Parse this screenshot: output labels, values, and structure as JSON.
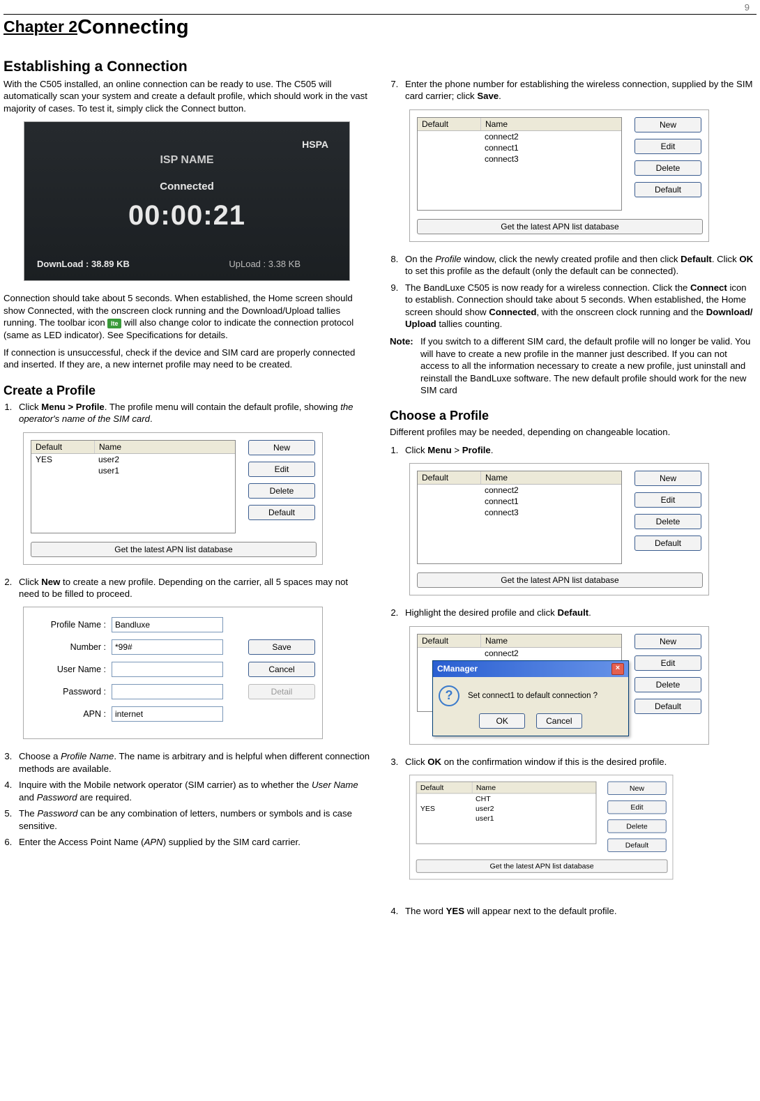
{
  "page_number": "9",
  "chapter": {
    "label": "Chapter 2",
    "title": "Connecting"
  },
  "sec_establish": "Establishing a Connection",
  "p_intro": "With the C505 installed, an online connection can be ready to use. The C505 will automatically scan your system and create a default profile, which should work in the vast majority of cases. To test it, simply click the Connect button.",
  "fig_conn": {
    "hspa": "HSPA",
    "isp": "ISP NAME",
    "status": "Connected",
    "clock": "00:00:21",
    "download": "DownLoad : 38.89 KB",
    "upload": "UpLoad : 3.38 KB"
  },
  "icon_lte": "lte",
  "p_conn1a": "Connection should take about 5 seconds. When established, the Home screen should show Connected, with the onscreen clock running and the Download/Upload tallies running. The toolbar icon ",
  "p_conn1b": " will also change color to indicate the connection protocol (same as LED indicator). See Specifications for details.",
  "p_conn2": "If connection is unsuccessful, check if the device and SIM card are properly connected and inserted. If they are, a new internet profile may need to be created.",
  "sec_create": "Create a Profile",
  "create_step1_a": "Click ",
  "create_step1_b": "Menu > Profile",
  "create_step1_c": ". The profile menu will contain the default profile, showing ",
  "create_step1_d": "the operator's name of the SIM card",
  "create_step1_e": ".",
  "pf_head_default": "Default",
  "pf_head_name": "Name",
  "pf1_rows": [
    {
      "def": "YES",
      "name": "user2"
    },
    {
      "def": "",
      "name": "user1"
    }
  ],
  "pf_conn_rows": [
    {
      "def": "",
      "name": "connect2"
    },
    {
      "def": "",
      "name": "connect1"
    },
    {
      "def": "",
      "name": "connect3"
    }
  ],
  "btn_new": "New",
  "btn_edit": "Edit",
  "btn_delete": "Delete",
  "btn_default": "Default",
  "btn_apn": "Get the latest APN list database",
  "create_step2_a": "Click ",
  "create_step2_b": "New",
  "create_step2_c": " to create a new profile. Depending on the carrier, all 5 spaces may not need to be filled to proceed.",
  "form": {
    "l_profile": "Profile Name :",
    "v_profile": "Bandluxe",
    "l_number": "Number :",
    "v_number": "*99#",
    "l_user": "User Name :",
    "l_pass": "Password :",
    "l_apn": "APN :",
    "v_apn": "internet",
    "save": "Save",
    "cancel": "Cancel",
    "detail": "Detail"
  },
  "create_step3_a": "Choose a ",
  "create_step3_b": "Profile Name",
  "create_step3_c": ". The name is arbitrary and is helpful when different connection methods are available.",
  "create_step4_a": "Inquire with the Mobile network operator (SIM carrier) as to whether the ",
  "create_step4_b": "User Name",
  "create_step4_c": " and ",
  "create_step4_d": "Password",
  "create_step4_e": " are required.",
  "create_step5_a": "The ",
  "create_step5_b": "Password",
  "create_step5_c": " can be any combination of letters, numbers or symbols and is case sensitive.",
  "create_step6_a": "Enter the Access Point Name (",
  "create_step6_b": "APN",
  "create_step6_c": ") supplied by the SIM card carrier.",
  "create_step7_a": "Enter the phone number for establishing the wireless connection, supplied by the SIM card carrier; click ",
  "create_step7_b": "Save",
  "create_step7_c": ".",
  "create_step8_a": "On the ",
  "create_step8_b": "Profile",
  "create_step8_c": " window, click the newly created profile and then click ",
  "create_step8_d": "Default",
  "create_step8_e": ". Click ",
  "create_step8_f": "OK",
  "create_step8_g": " to set this profile as the default (only the default can be connected).",
  "create_step9_a": "The BandLuxe C505 is now ready for a wireless connection. Click the ",
  "create_step9_b": "Connect",
  "create_step9_c": " icon to establish. Connection should take about 5 seconds. When established, the Home screen should show ",
  "create_step9_d": "Connected",
  "create_step9_e": ", with the onscreen clock running and the ",
  "create_step9_f": "Download/ Upload",
  "create_step9_g": " tallies counting.",
  "note_label": "Note:",
  "note_text": "If you switch to a different SIM card, the default profile will no longer be valid. You will have to create a new profile in the manner just described. If you can not access to all the information necessary to create a new profile, just uninstall and reinstall the BandLuxe software. The new default profile should work for the new SIM card",
  "sec_choose": "Choose a Profile",
  "choose_intro": "Different profiles may be needed, depending on changeable location.",
  "choose1_a": "Click ",
  "choose1_b": "Menu",
  "choose1_c": " > ",
  "choose1_d": "Profile",
  "choose1_e": ".",
  "choose2_a": "Highlight the desired profile and click ",
  "choose2_b": "Default",
  "choose2_c": ".",
  "confirm": {
    "title": "CManager",
    "msg": "Set connect1 to default connection ?",
    "ok": "OK",
    "cancel": "Cancel"
  },
  "pf_conn_rows2": [
    {
      "def": "",
      "name": "connect2"
    },
    {
      "def": "",
      "name": "connect1"
    }
  ],
  "choose3_a": "Click ",
  "choose3_b": "OK",
  "choose3_c": " on the confirmation window if this is the desired profile.",
  "pf_final_rows": [
    {
      "def": "",
      "name": "CHT"
    },
    {
      "def": "YES",
      "name": "user2"
    },
    {
      "def": "",
      "name": "user1"
    }
  ],
  "choose4_a": "The word ",
  "choose4_b": "YES",
  "choose4_c": " will appear next to the default profile."
}
